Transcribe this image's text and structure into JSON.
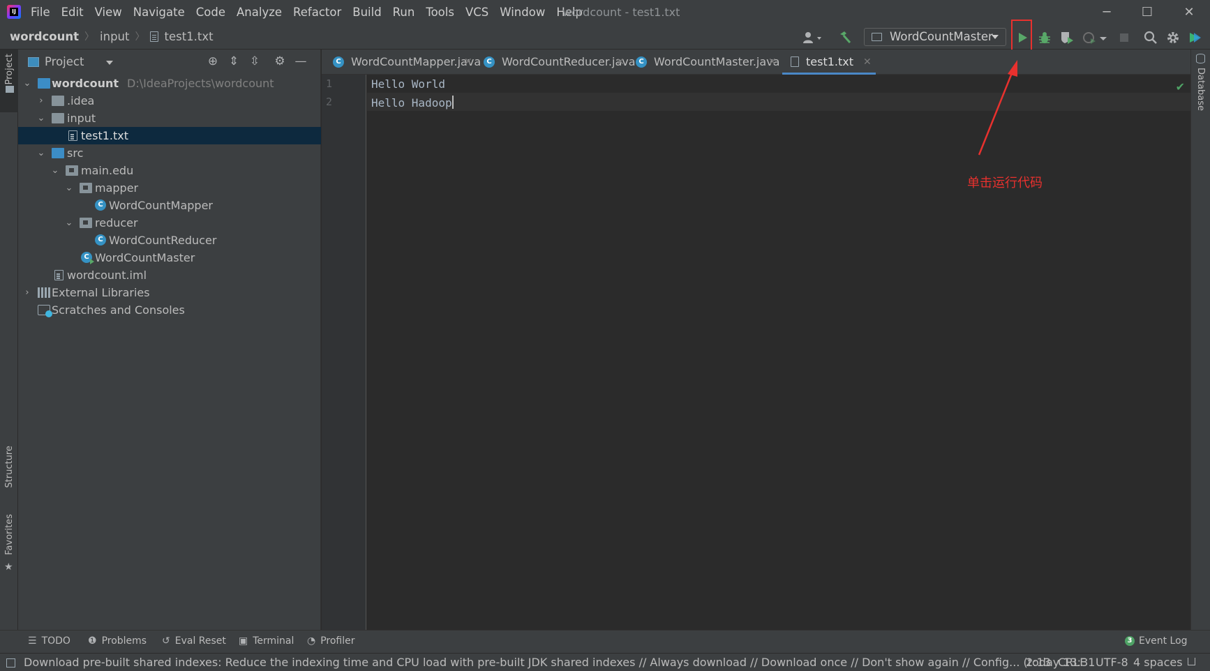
{
  "app": {
    "logo_text": "IJ"
  },
  "menu": [
    "File",
    "Edit",
    "View",
    "Navigate",
    "Code",
    "Analyze",
    "Refactor",
    "Build",
    "Run",
    "Tools",
    "VCS",
    "Window",
    "Help"
  ],
  "window_title": "wordcount - test1.txt",
  "window_controls": {
    "minimize": "─",
    "maximize": "☐",
    "close": "✕"
  },
  "breadcrumb": [
    "wordcount",
    "input",
    "test1.txt"
  ],
  "run_config": {
    "label": "WordCountMaster"
  },
  "project_panel": {
    "title": "Project",
    "tree": [
      {
        "name": "wordcount",
        "path": "D:\\IdeaProjects\\wordcount"
      },
      {
        "name": ".idea"
      },
      {
        "name": "input"
      },
      {
        "name": "test1.txt"
      },
      {
        "name": "src"
      },
      {
        "name": "main.edu"
      },
      {
        "name": "mapper"
      },
      {
        "name": "WordCountMapper"
      },
      {
        "name": "reducer"
      },
      {
        "name": "WordCountReducer"
      },
      {
        "name": "WordCountMaster"
      },
      {
        "name": "wordcount.iml"
      },
      {
        "name": "External Libraries"
      },
      {
        "name": "Scratches and Consoles"
      }
    ]
  },
  "tabs": [
    {
      "label": "WordCountMapper.java",
      "icon": "class-icon",
      "active": false
    },
    {
      "label": "WordCountReducer.java",
      "icon": "class-icon",
      "active": false
    },
    {
      "label": "WordCountMaster.java",
      "icon": "class-icon",
      "active": false
    },
    {
      "label": "test1.txt",
      "icon": "text-file-icon",
      "active": true
    }
  ],
  "editor": {
    "lines": [
      {
        "number": "1",
        "text": "Hello World"
      },
      {
        "number": "2",
        "text": "Hello Hadoop"
      }
    ],
    "caret": {
      "line": 2,
      "column": 13
    }
  },
  "side_strips": {
    "left_top": "Project",
    "left_structure": "Structure",
    "left_favorites": "Favorites",
    "right": "Database"
  },
  "annotation": {
    "text": "单击运行代码",
    "color": "#e8312e"
  },
  "bottom_tools": [
    {
      "label": "TODO",
      "icon": "list-icon"
    },
    {
      "label": "Problems",
      "icon": "warning-icon"
    },
    {
      "label": "Eval Reset",
      "icon": "reset-icon"
    },
    {
      "label": "Terminal",
      "icon": "terminal-icon"
    },
    {
      "label": "Profiler",
      "icon": "profiler-icon"
    }
  ],
  "event_log": {
    "label": "Event Log",
    "count": "3"
  },
  "status": {
    "message": "Download pre-built shared indexes: Reduce the indexing time and CPU load with pre-built JDK shared indexes // Always download // Download once // Don't show again // Config... (today 13:31",
    "position": "2:13",
    "line_separator": "CRLF",
    "encoding": "UTF-8",
    "indent": "4 spaces"
  },
  "colors": {
    "accent": "#4a88c7",
    "run_green": "#59a869",
    "highlight_red": "#e8312e",
    "class_icon": "#3592c4"
  }
}
